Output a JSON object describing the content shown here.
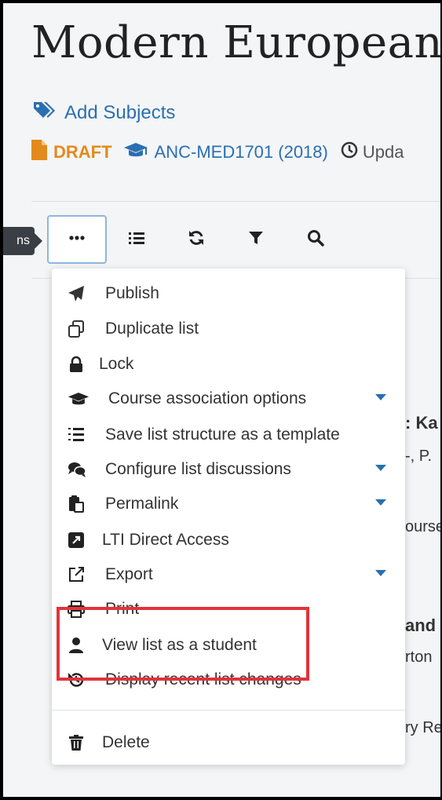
{
  "header": {
    "title": "Modern European",
    "add_subjects": "Add Subjects",
    "status": "DRAFT",
    "course": "ANC-MED1701 (2018)",
    "updated": "Upda"
  },
  "toolbar": {
    "tooltip": "ns",
    "buttons": [
      {
        "name": "more-options",
        "icon": "ellipsis-icon"
      },
      {
        "name": "list-view",
        "icon": "list-icon"
      },
      {
        "name": "sync",
        "icon": "refresh-icon"
      },
      {
        "name": "filter",
        "icon": "filter-icon"
      },
      {
        "name": "search",
        "icon": "search-icon"
      }
    ]
  },
  "background": {
    "t1": ": Ka",
    "t2": "-, P.",
    "t3": "ourse",
    "t4": "and",
    "t5": "rton",
    "t6": "ry Re"
  },
  "menu": {
    "items": [
      {
        "label": "Publish",
        "icon": "paper-plane-icon",
        "has_submenu": false
      },
      {
        "label": "Duplicate list",
        "icon": "copy-icon",
        "has_submenu": false
      },
      {
        "label": "Lock",
        "icon": "lock-icon",
        "has_submenu": false
      },
      {
        "label": "Course association options",
        "icon": "graduation-cap-icon",
        "has_submenu": true
      },
      {
        "label": "Save list structure as a template",
        "icon": "list-ordered-icon",
        "has_submenu": false
      },
      {
        "label": "Configure list discussions",
        "icon": "comments-icon",
        "has_submenu": true
      },
      {
        "label": "Permalink",
        "icon": "clipboard-icon",
        "has_submenu": true
      },
      {
        "label": "LTI Direct Access",
        "icon": "external-square-icon",
        "has_submenu": false
      },
      {
        "label": "Export",
        "icon": "export-icon",
        "has_submenu": true
      },
      {
        "label": "Print",
        "icon": "print-icon",
        "has_submenu": false
      },
      {
        "label": "View list as a student",
        "icon": "user-icon",
        "has_submenu": false
      },
      {
        "label": "Display recent list changes",
        "icon": "history-icon",
        "has_submenu": false
      },
      {
        "label": "Delete",
        "icon": "trash-icon",
        "has_submenu": false
      }
    ]
  },
  "colors": {
    "link": "#2a6fb0",
    "draft": "#e38a1c",
    "highlight": "#e0343a"
  }
}
